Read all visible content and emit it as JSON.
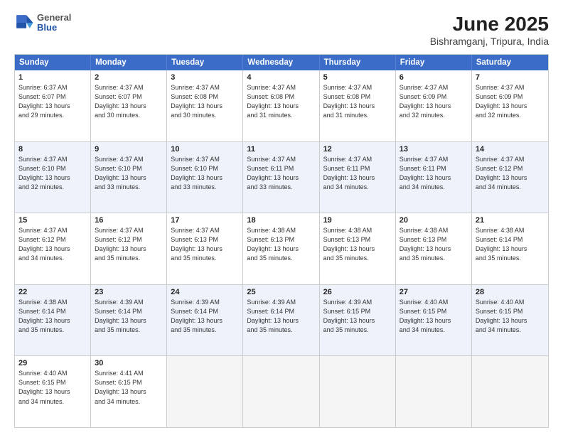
{
  "header": {
    "logo": {
      "general": "General",
      "blue": "Blue"
    },
    "title": "June 2025",
    "location": "Bishramganj, Tripura, India"
  },
  "calendar": {
    "days_of_week": [
      "Sunday",
      "Monday",
      "Tuesday",
      "Wednesday",
      "Thursday",
      "Friday",
      "Saturday"
    ],
    "weeks": [
      {
        "alt": false,
        "cells": [
          {
            "day": "1",
            "sunrise": "6:37 AM",
            "sunset": "6:07 PM",
            "daylight": "13 hours and 29 minutes."
          },
          {
            "day": "2",
            "sunrise": "4:37 AM",
            "sunset": "6:07 PM",
            "daylight": "13 hours and 30 minutes."
          },
          {
            "day": "3",
            "sunrise": "4:37 AM",
            "sunset": "6:08 PM",
            "daylight": "13 hours and 30 minutes."
          },
          {
            "day": "4",
            "sunrise": "4:37 AM",
            "sunset": "6:08 PM",
            "daylight": "13 hours and 31 minutes."
          },
          {
            "day": "5",
            "sunrise": "4:37 AM",
            "sunset": "6:08 PM",
            "daylight": "13 hours and 31 minutes."
          },
          {
            "day": "6",
            "sunrise": "4:37 AM",
            "sunset": "6:09 PM",
            "daylight": "13 hours and 32 minutes."
          },
          {
            "day": "7",
            "sunrise": "4:37 AM",
            "sunset": "6:09 PM",
            "daylight": "13 hours and 32 minutes."
          }
        ]
      },
      {
        "alt": true,
        "cells": [
          {
            "day": "8",
            "sunrise": "4:37 AM",
            "sunset": "6:10 PM",
            "daylight": "13 hours and 32 minutes."
          },
          {
            "day": "9",
            "sunrise": "4:37 AM",
            "sunset": "6:10 PM",
            "daylight": "13 hours and 33 minutes."
          },
          {
            "day": "10",
            "sunrise": "4:37 AM",
            "sunset": "6:10 PM",
            "daylight": "13 hours and 33 minutes."
          },
          {
            "day": "11",
            "sunrise": "4:37 AM",
            "sunset": "6:11 PM",
            "daylight": "13 hours and 33 minutes."
          },
          {
            "day": "12",
            "sunrise": "4:37 AM",
            "sunset": "6:11 PM",
            "daylight": "13 hours and 34 minutes."
          },
          {
            "day": "13",
            "sunrise": "4:37 AM",
            "sunset": "6:11 PM",
            "daylight": "13 hours and 34 minutes."
          },
          {
            "day": "14",
            "sunrise": "4:37 AM",
            "sunset": "6:12 PM",
            "daylight": "13 hours and 34 minutes."
          }
        ]
      },
      {
        "alt": false,
        "cells": [
          {
            "day": "15",
            "sunrise": "4:37 AM",
            "sunset": "6:12 PM",
            "daylight": "13 hours and 34 minutes."
          },
          {
            "day": "16",
            "sunrise": "4:37 AM",
            "sunset": "6:12 PM",
            "daylight": "13 hours and 35 minutes."
          },
          {
            "day": "17",
            "sunrise": "4:37 AM",
            "sunset": "6:13 PM",
            "daylight": "13 hours and 35 minutes."
          },
          {
            "day": "18",
            "sunrise": "4:38 AM",
            "sunset": "6:13 PM",
            "daylight": "13 hours and 35 minutes."
          },
          {
            "day": "19",
            "sunrise": "4:38 AM",
            "sunset": "6:13 PM",
            "daylight": "13 hours and 35 minutes."
          },
          {
            "day": "20",
            "sunrise": "4:38 AM",
            "sunset": "6:13 PM",
            "daylight": "13 hours and 35 minutes."
          },
          {
            "day": "21",
            "sunrise": "4:38 AM",
            "sunset": "6:14 PM",
            "daylight": "13 hours and 35 minutes."
          }
        ]
      },
      {
        "alt": true,
        "cells": [
          {
            "day": "22",
            "sunrise": "4:38 AM",
            "sunset": "6:14 PM",
            "daylight": "13 hours and 35 minutes."
          },
          {
            "day": "23",
            "sunrise": "4:39 AM",
            "sunset": "6:14 PM",
            "daylight": "13 hours and 35 minutes."
          },
          {
            "day": "24",
            "sunrise": "4:39 AM",
            "sunset": "6:14 PM",
            "daylight": "13 hours and 35 minutes."
          },
          {
            "day": "25",
            "sunrise": "4:39 AM",
            "sunset": "6:14 PM",
            "daylight": "13 hours and 35 minutes."
          },
          {
            "day": "26",
            "sunrise": "4:39 AM",
            "sunset": "6:15 PM",
            "daylight": "13 hours and 35 minutes."
          },
          {
            "day": "27",
            "sunrise": "4:40 AM",
            "sunset": "6:15 PM",
            "daylight": "13 hours and 34 minutes."
          },
          {
            "day": "28",
            "sunrise": "4:40 AM",
            "sunset": "6:15 PM",
            "daylight": "13 hours and 34 minutes."
          }
        ]
      },
      {
        "alt": false,
        "cells": [
          {
            "day": "29",
            "sunrise": "4:40 AM",
            "sunset": "6:15 PM",
            "daylight": "13 hours and 34 minutes."
          },
          {
            "day": "30",
            "sunrise": "4:41 AM",
            "sunset": "6:15 PM",
            "daylight": "13 hours and 34 minutes."
          },
          {
            "day": "",
            "sunrise": "",
            "sunset": "",
            "daylight": ""
          },
          {
            "day": "",
            "sunrise": "",
            "sunset": "",
            "daylight": ""
          },
          {
            "day": "",
            "sunrise": "",
            "sunset": "",
            "daylight": ""
          },
          {
            "day": "",
            "sunrise": "",
            "sunset": "",
            "daylight": ""
          },
          {
            "day": "",
            "sunrise": "",
            "sunset": "",
            "daylight": ""
          }
        ]
      }
    ]
  }
}
